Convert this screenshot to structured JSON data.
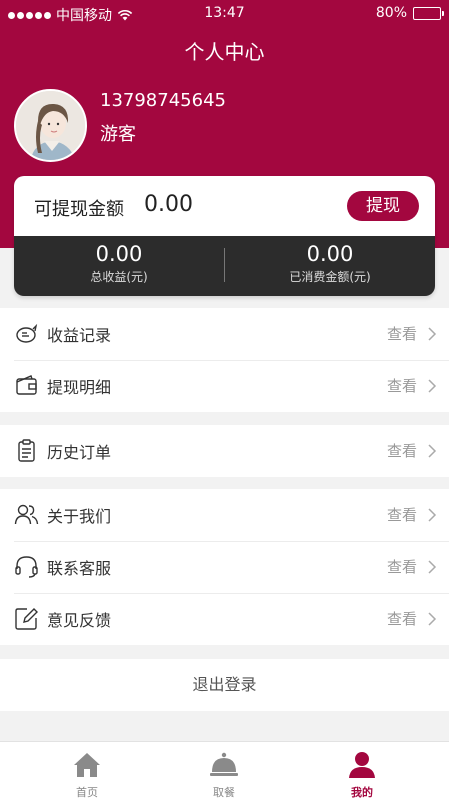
{
  "status_bar": {
    "carrier": "中国移动",
    "time": "13:47",
    "battery": "80%",
    "battery_level": 0.8
  },
  "header": {
    "title": "个人中心"
  },
  "profile": {
    "phone": "13798745645",
    "role": "游客"
  },
  "wallet": {
    "withdrawable_label": "可提现金额",
    "withdrawable_amount": "0.00",
    "withdraw_button": "提现",
    "total_income_value": "0.00",
    "total_income_label": "总收益(元)",
    "spent_value": "0.00",
    "spent_label": "已消费金额(元)"
  },
  "menu": {
    "view_label": "查看",
    "groups": [
      {
        "items": [
          {
            "label": "收益记录",
            "icon": "piggy-bank-icon"
          },
          {
            "label": "提现明细",
            "icon": "wallet-icon"
          }
        ]
      },
      {
        "items": [
          {
            "label": "历史订单",
            "icon": "clipboard-icon"
          }
        ]
      },
      {
        "items": [
          {
            "label": "关于我们",
            "icon": "users-icon"
          },
          {
            "label": "联系客服",
            "icon": "headset-icon"
          },
          {
            "label": "意见反馈",
            "icon": "edit-icon"
          }
        ]
      }
    ]
  },
  "logout": "退出登录",
  "tabbar": {
    "active_color": "#a3073f",
    "items": [
      {
        "label": "首页",
        "icon": "home-icon"
      },
      {
        "label": "取餐",
        "icon": "food-cloche-icon"
      },
      {
        "label": "我的",
        "icon": "user-icon"
      }
    ]
  },
  "colors": {
    "brand": "#a3073f",
    "stats_bg": "#2c2c2c"
  }
}
